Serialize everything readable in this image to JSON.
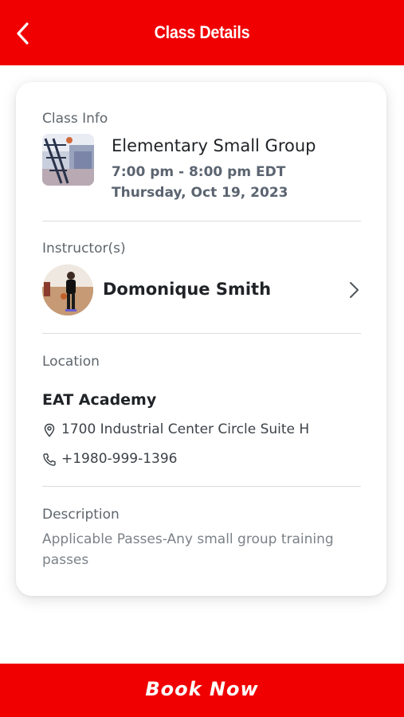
{
  "header": {
    "title": "Class Details",
    "back_icon": "chevron-left-icon"
  },
  "class_info": {
    "label": "Class Info",
    "name": "Elementary Small Group",
    "time": "7:00 pm - 8:00 pm EDT",
    "date": "Thursday, Oct 19, 2023"
  },
  "instructor": {
    "label": "Instructor(s)",
    "name": "Domonique Smith"
  },
  "location": {
    "label": "Location",
    "name": "EAT Academy",
    "address": "1700 Industrial Center Circle Suite H",
    "phone": "+1980-999-1396"
  },
  "description": {
    "label": "Description",
    "text": "Applicable Passes-Any small group training passes"
  },
  "footer": {
    "book_label": "Book Now"
  },
  "colors": {
    "brand": "#f00000",
    "text_dark": "#1f2226",
    "text_muted": "#5f666c"
  }
}
